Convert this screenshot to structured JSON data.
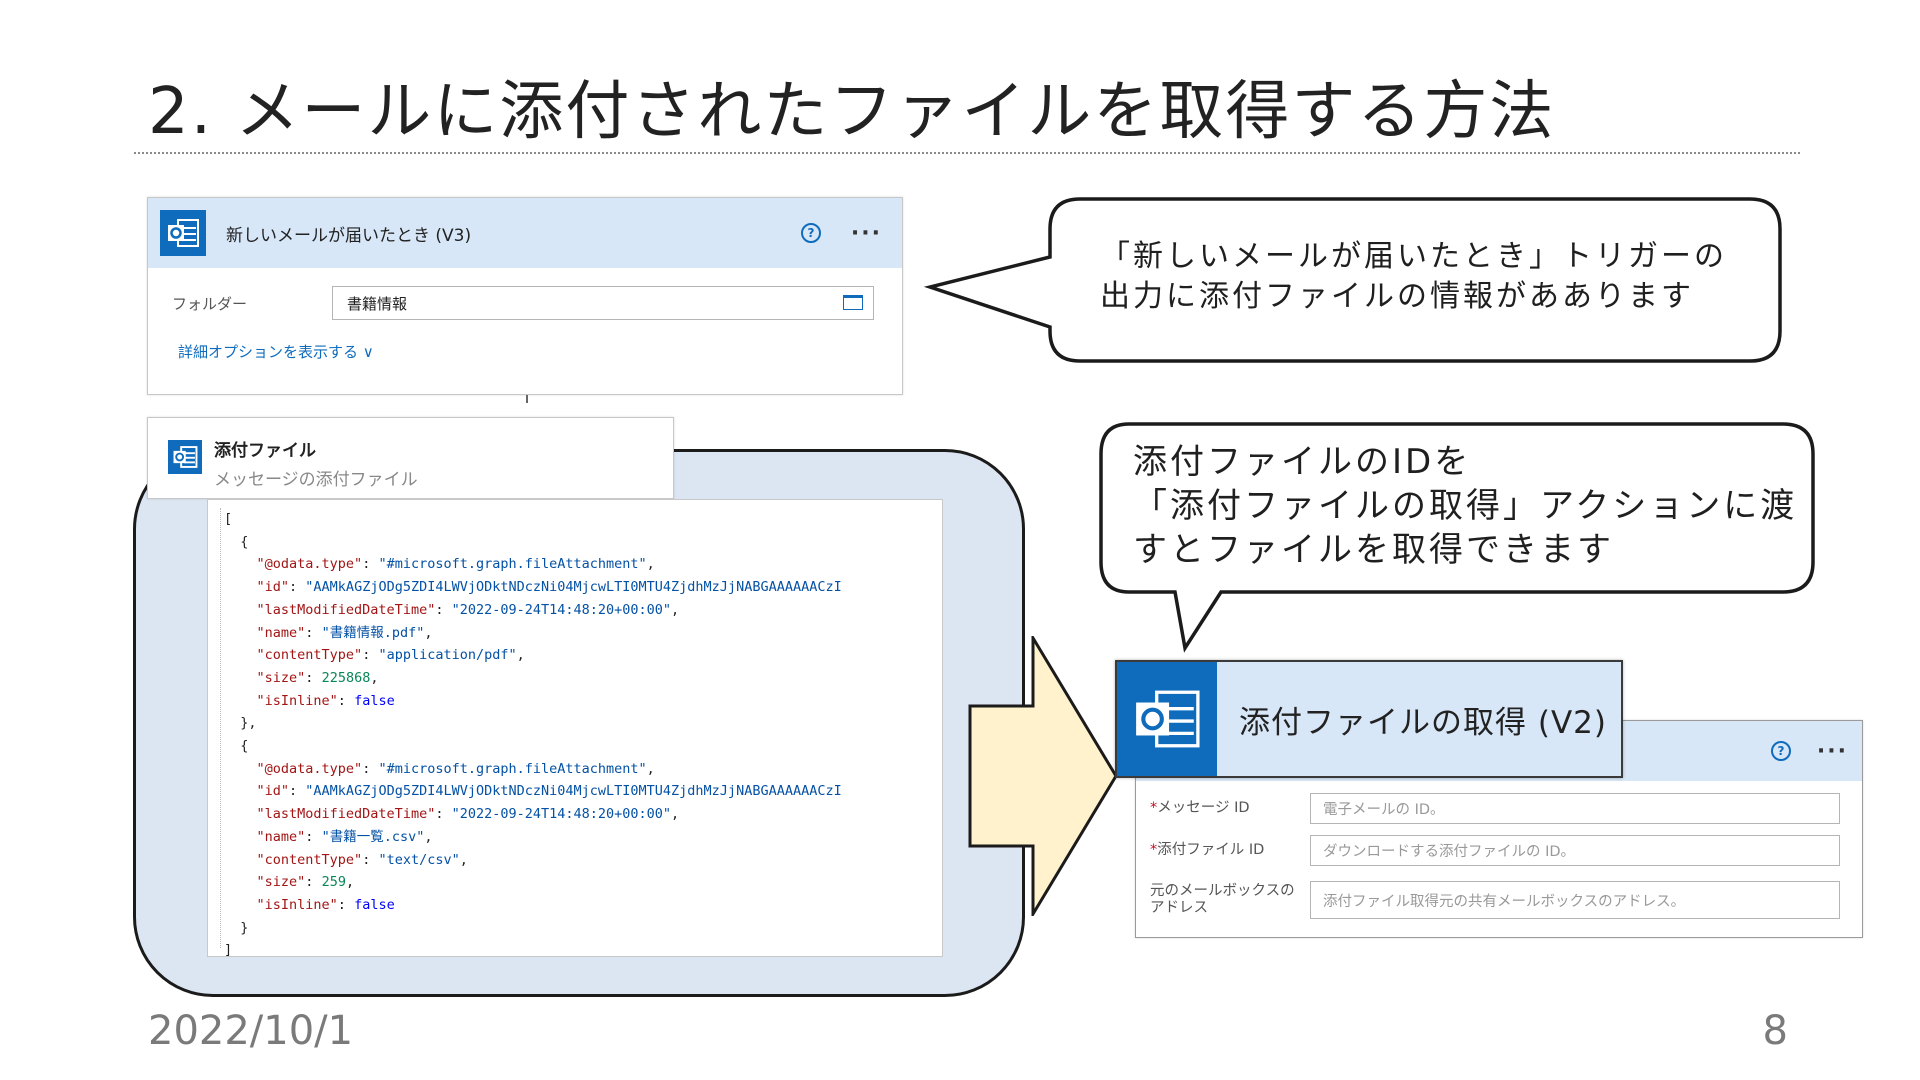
{
  "slide": {
    "title": "2. メールに添付されたファイルを取得する方法",
    "date": "2022/10/1",
    "page_number": "8"
  },
  "trigger_card": {
    "title": "新しいメールが届いたとき (V3)",
    "folder_label": "フォルダー",
    "folder_value": "書籍情報",
    "advanced_link": "詳細オプションを表示する ∨",
    "icons": [
      "outlook-icon",
      "help-icon",
      "more-icon",
      "folder-picker-icon"
    ]
  },
  "attachments_card": {
    "title": "添付ファイル",
    "subtitle": "メッセージの添付ファイル"
  },
  "json_output": {
    "lines": [
      "[",
      "  {",
      "    \"@odata.type\": \"#microsoft.graph.fileAttachment\",",
      "    \"id\": \"AAMkAGZjODg5ZDI4LWVjODktNDczNi04MjcwLTI0MTU4ZjdhMzJjNABGAAAAAACzI",
      "    \"lastModifiedDateTime\": \"2022-09-24T14:48:20+00:00\",",
      "    \"name\": \"書籍情報.pdf\",",
      "    \"contentType\": \"application/pdf\",",
      "    \"size\": 225868,",
      "    \"isInline\": false",
      "  },",
      "  {",
      "    \"@odata.type\": \"#microsoft.graph.fileAttachment\",",
      "    \"id\": \"AAMkAGZjODg5ZDI4LWVjODktNDczNi04MjcwLTI0MTU4ZjdhMzJjNABGAAAAAACzI",
      "    \"lastModifiedDateTime\": \"2022-09-24T14:48:20+00:00\",",
      "    \"name\": \"書籍一覧.csv\",",
      "    \"contentType\": \"text/csv\",",
      "    \"size\": 259,",
      "    \"isInline\": false",
      "  }",
      "]"
    ]
  },
  "bubble_trigger": {
    "line1": "「新しいメールが届いたとき」トリガーの",
    "line2": "出力に添付ファイルの情報がああります"
  },
  "bubble_action": {
    "line1": "添付ファイルのIDを",
    "line2": "「添付ファイルの取得」アクションに渡",
    "line3": "すとファイルを取得できます"
  },
  "get_attachment_card": {
    "title": "添付ファイルの取得 (V2)",
    "fields": [
      {
        "required": "*",
        "label": "メッセージ ID",
        "placeholder": "電子メールの ID。"
      },
      {
        "required": "*",
        "label": "添付ファイル ID",
        "placeholder": "ダウンロードする添付ファイルの ID。"
      },
      {
        "required": "",
        "label": "元のメールボックスの アドレス",
        "placeholder": "添付ファイル取得元の共有メールボックスのアドレス。"
      }
    ]
  },
  "colors": {
    "outlook_blue": "#0f6cbd",
    "card_header": "#d7e7f7",
    "frame_fill": "#dce6f2",
    "arrow_fill": "#fff2cc"
  }
}
